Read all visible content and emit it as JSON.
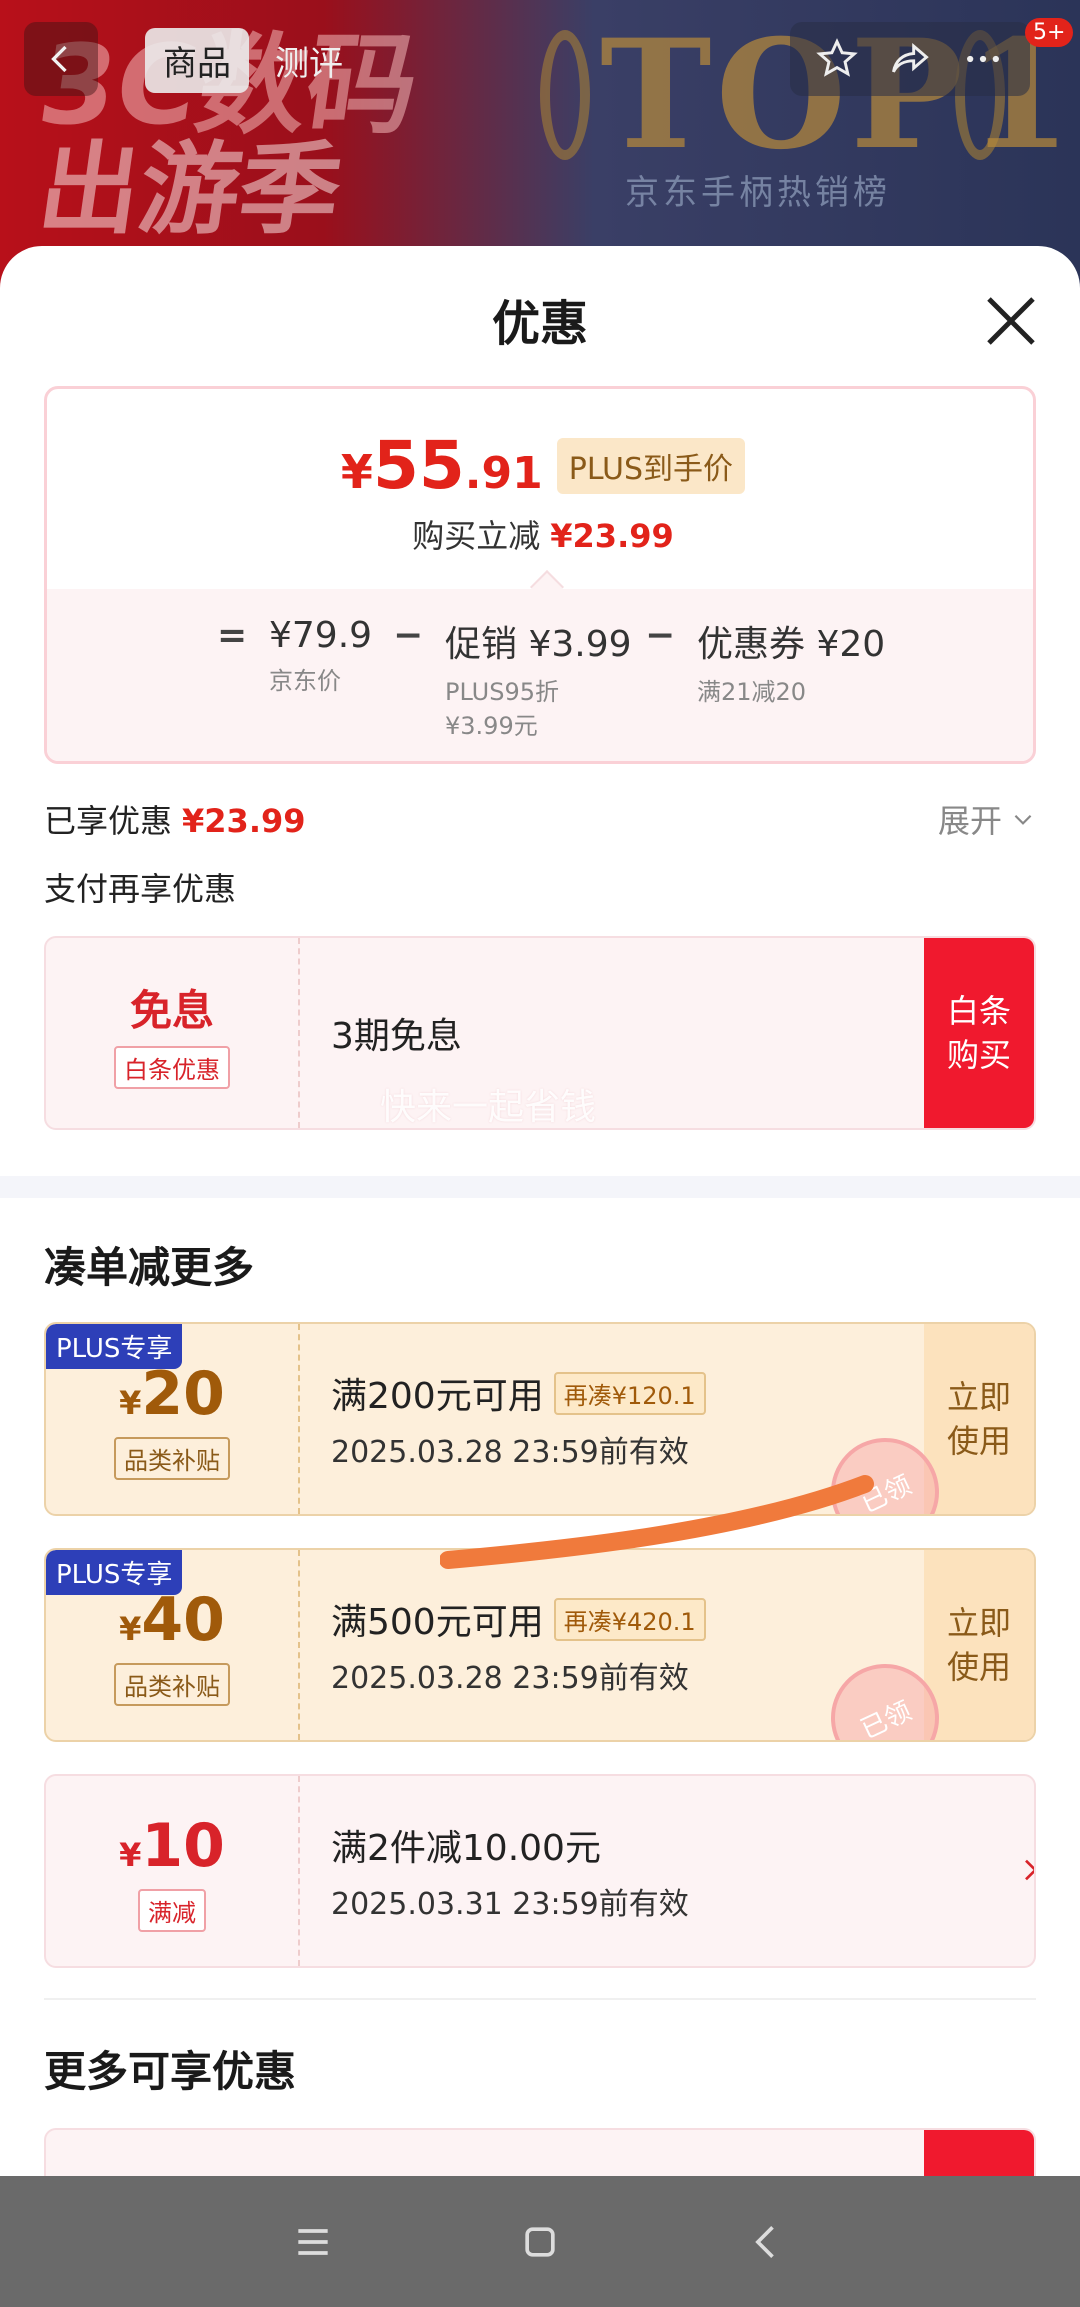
{
  "header": {
    "tabs": [
      "商品",
      "测评"
    ],
    "bg_promo_line1": "3C数码",
    "bg_promo_line2": "出游季",
    "bg_rank_title": "TOP1",
    "bg_rank_subtitle": "京东手柄热销榜",
    "badge": "5+"
  },
  "sheet": {
    "title": "优惠",
    "price": {
      "symbol": "¥",
      "int": "55",
      "dec": ".91",
      "tag": "PLUS到手价"
    },
    "reduce": {
      "label": "购买立减",
      "amount": "¥23.99"
    },
    "breakdown": {
      "eq": "=",
      "jd_price": "¥79.9",
      "jd_price_label": "京东价",
      "minus1": "−",
      "promo": "促销 ¥3.99",
      "promo_sub1": "PLUS95折",
      "promo_sub2": "¥3.99元",
      "minus2": "−",
      "coupon": "优惠券 ¥20",
      "coupon_sub": "满21减20"
    },
    "enjoyed": {
      "label": "已享优惠",
      "amount": "¥23.99"
    },
    "expand": "展开",
    "pay_label": "支付再享优惠",
    "baitiao": {
      "big": "免息",
      "tag": "白条优惠",
      "title": "3期免息",
      "watermark": "快来一起省钱",
      "button_l1": "白条",
      "button_l2": "购买"
    },
    "section1": "凑单减更多",
    "coupons": [
      {
        "corner": "PLUS专享",
        "sym": "¥",
        "amount": "20",
        "tag": "品类补贴",
        "title": "满200元可用",
        "extra": "再凑¥120.1",
        "date": "2025.03.28 23:59前有效",
        "btn_l1": "立即",
        "btn_l2": "使用",
        "stamp": "已领"
      },
      {
        "corner": "PLUS专享",
        "sym": "¥",
        "amount": "40",
        "tag": "品类补贴",
        "title": "满500元可用",
        "extra": "再凑¥420.1",
        "date": "2025.03.28 23:59前有效",
        "btn_l1": "立即",
        "btn_l2": "使用",
        "stamp": "已领"
      }
    ],
    "fullreduce": {
      "sym": "¥",
      "amount": "10",
      "tag": "满减",
      "title": "满2件减10.00元",
      "date": "2025.03.31 23:59前有效"
    },
    "section2": "更多可享优惠"
  },
  "colors": {
    "accent_red": "#e2231a",
    "plus_blue": "#2d3fb8",
    "gold_text": "#a05a0a"
  },
  "icons": [
    "back-icon",
    "star-icon",
    "share-icon",
    "more-icon",
    "close-icon",
    "chevron-down-icon",
    "chevron-right-icon",
    "menu-icon",
    "home-icon",
    "nav-back-icon"
  ]
}
